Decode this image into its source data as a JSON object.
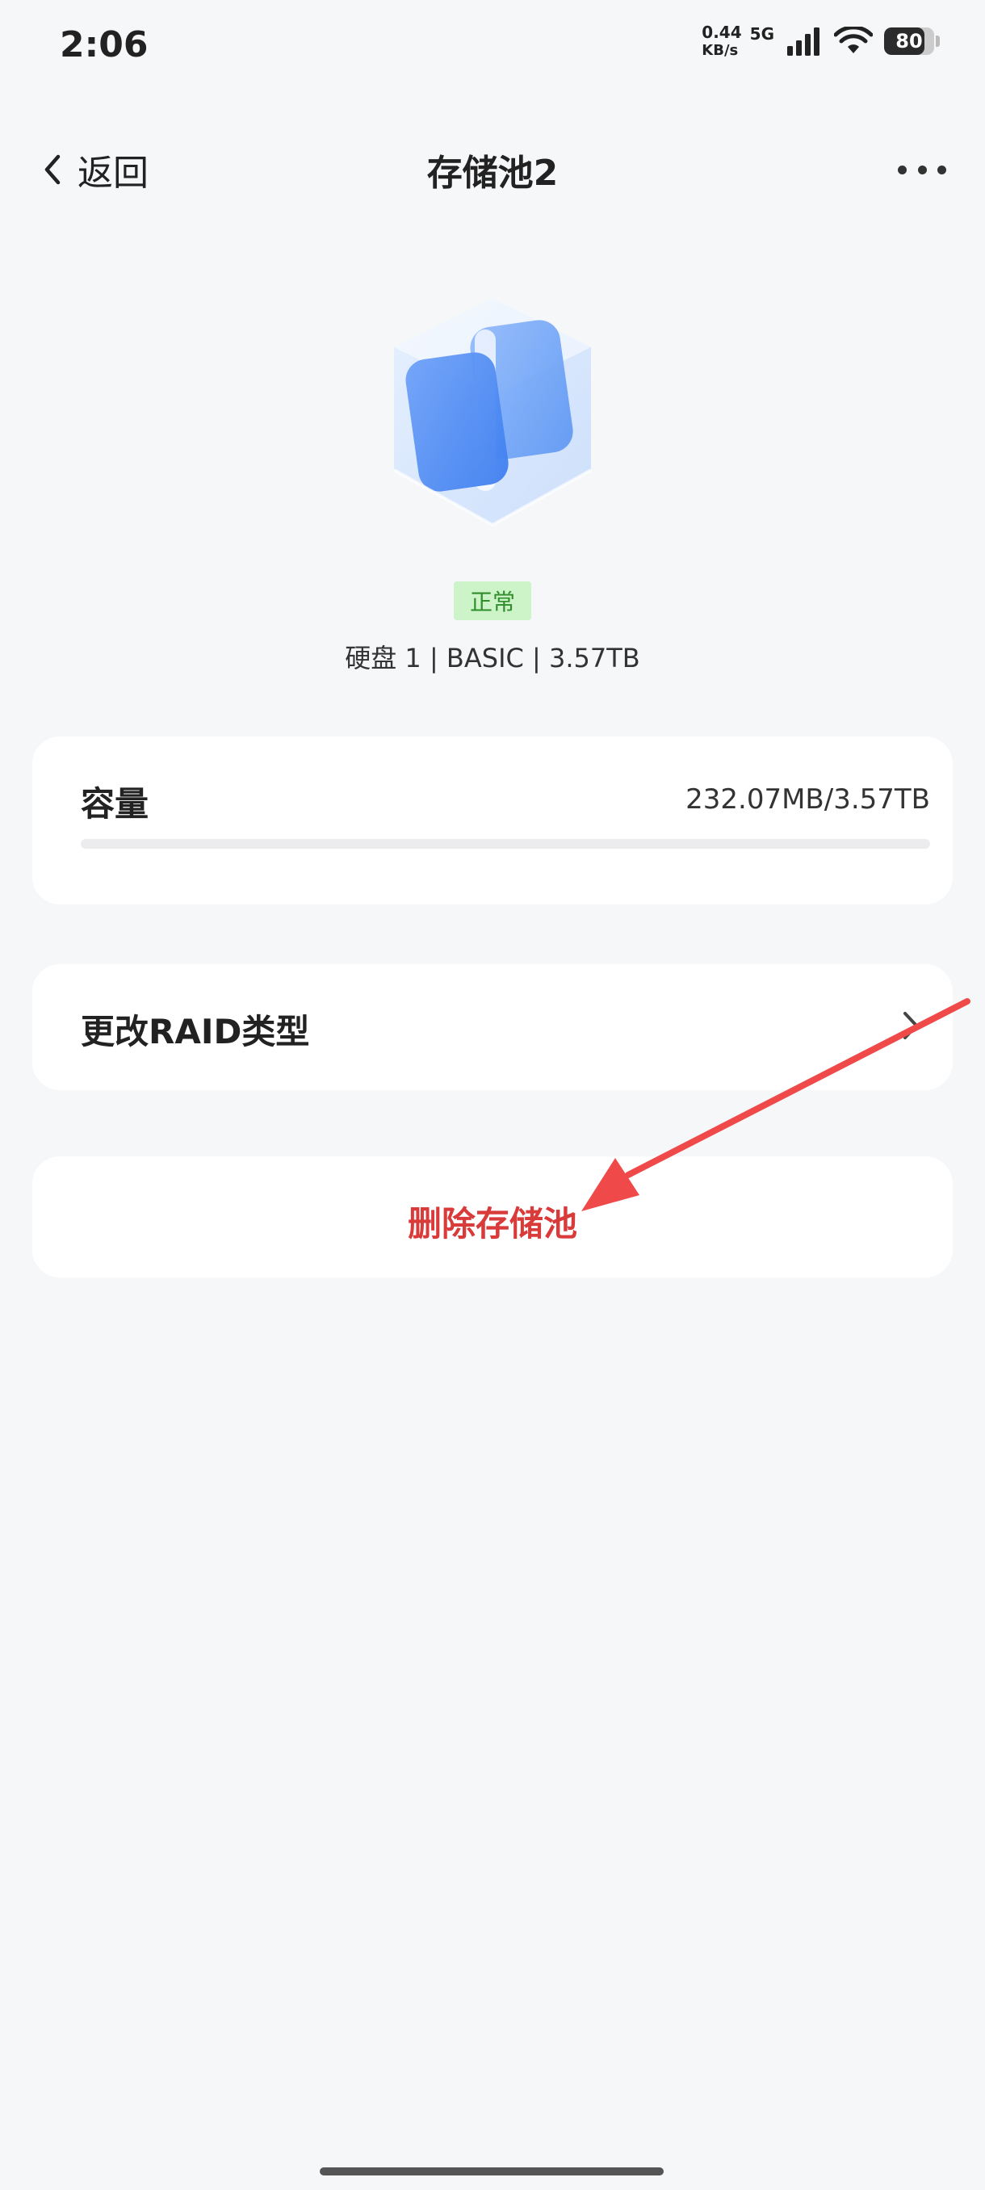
{
  "status_bar": {
    "time": "2:06",
    "net_speed_value": "0.44",
    "net_speed_unit": "KB/s",
    "network": "5G",
    "battery": "80",
    "battery_level": 0.8
  },
  "header": {
    "back_label": "返回",
    "title": "存储池2"
  },
  "pool": {
    "status": "正常",
    "disk_info": "硬盘 1 | BASIC | 3.57TB"
  },
  "capacity": {
    "label": "容量",
    "value": "232.07MB/3.57TB",
    "used_fraction": 6.34e-05
  },
  "raid": {
    "label": "更改RAID类型"
  },
  "delete": {
    "label": "删除存储池"
  },
  "colors": {
    "accent_blue": "#3b7bf6",
    "danger_red": "#d93a3a",
    "badge_bg": "#cdf3c8",
    "badge_text": "#2f8d2a",
    "annotation_red": "#f0494a"
  }
}
